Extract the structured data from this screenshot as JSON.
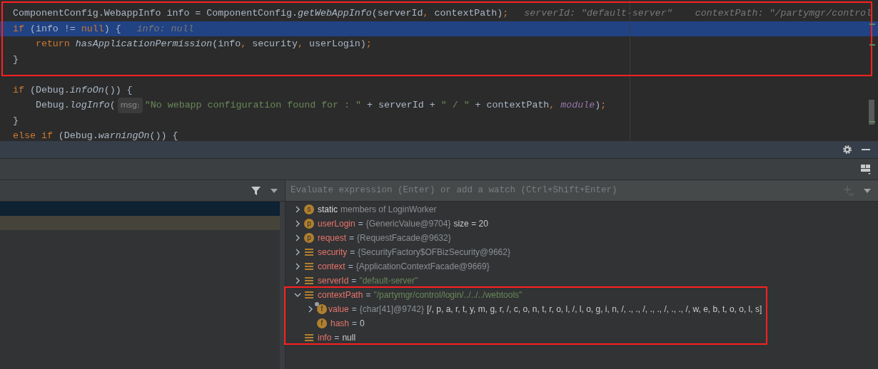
{
  "editor": {
    "lines": [
      {
        "highlighted": false,
        "segments": [
          {
            "kind": "code",
            "tokens": [
              {
                "kind": "plain",
                "text": "ComponentConfig.WebappInfo info = ComponentConfig."
              },
              {
                "kind": "method",
                "text": "getWebAppInfo"
              },
              {
                "kind": "plain",
                "text": "(serverId"
              },
              {
                "kind": "keyword",
                "text": ","
              },
              {
                "kind": "plain",
                "text": " contextPath)"
              },
              {
                "kind": "keyword",
                "text": ";"
              }
            ]
          },
          {
            "kind": "hint",
            "text": "serverId: \"default-server\""
          },
          {
            "kind": "hint",
            "text": "contextPath: \"/partymgr/control"
          }
        ]
      },
      {
        "highlighted": true,
        "segments": [
          {
            "kind": "code",
            "tokens": [
              {
                "kind": "keyword",
                "text": "if"
              },
              {
                "kind": "plain",
                "text": " (info != "
              },
              {
                "kind": "keyword",
                "text": "null"
              },
              {
                "kind": "plain",
                "text": ") {"
              }
            ]
          },
          {
            "kind": "hint",
            "text": "info: null"
          }
        ]
      },
      {
        "highlighted": false,
        "segments": [
          {
            "kind": "code",
            "tokens": [
              {
                "kind": "keyword",
                "text": "    return "
              },
              {
                "kind": "method",
                "text": "hasApplicationPermission"
              },
              {
                "kind": "plain",
                "text": "(info"
              },
              {
                "kind": "keyword",
                "text": ","
              },
              {
                "kind": "plain",
                "text": " security"
              },
              {
                "kind": "keyword",
                "text": ","
              },
              {
                "kind": "plain",
                "text": " userLogin)"
              },
              {
                "kind": "keyword",
                "text": ";"
              }
            ]
          }
        ]
      },
      {
        "highlighted": false,
        "segments": [
          {
            "kind": "code",
            "tokens": [
              {
                "kind": "plain",
                "text": "}"
              }
            ]
          }
        ]
      },
      {
        "highlighted": false
      },
      {
        "highlighted": false,
        "segments": [
          {
            "kind": "code",
            "tokens": [
              {
                "kind": "keyword",
                "text": "if"
              },
              {
                "kind": "plain",
                "text": " (Debug."
              },
              {
                "kind": "method",
                "text": "infoOn"
              },
              {
                "kind": "plain",
                "text": "()) {"
              }
            ]
          }
        ]
      },
      {
        "highlighted": false,
        "segments": [
          {
            "kind": "code",
            "tokens": [
              {
                "kind": "plain",
                "text": "    Debug."
              },
              {
                "kind": "method",
                "text": "logInfo"
              },
              {
                "kind": "plain",
                "text": "("
              }
            ]
          },
          {
            "kind": "param",
            "text": "msg:"
          },
          {
            "kind": "code",
            "tokens": [
              {
                "kind": "string",
                "text": "\"No webapp configuration found for : \""
              },
              {
                "kind": "plain",
                "text": " + serverId + "
              },
              {
                "kind": "string",
                "text": "\" / \""
              },
              {
                "kind": "plain",
                "text": " + contextPath"
              },
              {
                "kind": "keyword",
                "text": ","
              },
              {
                "kind": "field",
                "text": " module"
              },
              {
                "kind": "plain",
                "text": ")"
              },
              {
                "kind": "keyword",
                "text": ";"
              }
            ]
          }
        ]
      },
      {
        "highlighted": false,
        "segments": [
          {
            "kind": "code",
            "tokens": [
              {
                "kind": "plain",
                "text": "}"
              }
            ]
          }
        ]
      },
      {
        "highlighted": false,
        "segments": [
          {
            "kind": "code",
            "tokens": [
              {
                "kind": "keyword",
                "text": "else if"
              },
              {
                "kind": "plain",
                "text": " (Debug."
              },
              {
                "kind": "method",
                "text": "warningOn"
              },
              {
                "kind": "plain",
                "text": "()) {"
              }
            ]
          }
        ]
      }
    ]
  },
  "frames": {
    "rows": [
      {
        "selected": true
      },
      {
        "selected": false
      }
    ]
  },
  "evaluate": {
    "placeholder": "Evaluate expression (Enter) or add a watch (Ctrl+Shift+Enter)"
  },
  "variables": [
    {
      "kind": "static",
      "expandable": true,
      "expanded": false,
      "icon": {
        "kind": "letter",
        "letter": "s"
      },
      "name": "static",
      "value": [
        {
          "kind": "ref",
          "text": "members of LoginWorker"
        }
      ]
    },
    {
      "kind": "variable",
      "expandable": true,
      "expanded": false,
      "icon": {
        "kind": "letter",
        "letter": "p"
      },
      "name": "userLogin",
      "separator": "=",
      "value": [
        {
          "kind": "ref",
          "text": "{GenericValue@9704}"
        },
        {
          "kind": "plain",
          "text": "size = 20"
        }
      ]
    },
    {
      "kind": "variable",
      "expandable": true,
      "expanded": false,
      "icon": {
        "kind": "letter",
        "letter": "p"
      },
      "name": "request",
      "separator": "=",
      "value": [
        {
          "kind": "ref",
          "text": "{RequestFacade@9632}"
        }
      ]
    },
    {
      "kind": "variable",
      "expandable": true,
      "expanded": false,
      "icon": {
        "kind": "list"
      },
      "name": "security",
      "separator": "=",
      "value": [
        {
          "kind": "ref",
          "text": "{SecurityFactory$OFBizSecurity@9662}"
        }
      ]
    },
    {
      "kind": "variable",
      "expandable": true,
      "expanded": false,
      "icon": {
        "kind": "list"
      },
      "name": "context",
      "separator": "=",
      "value": [
        {
          "kind": "ref",
          "text": "{ApplicationContextFacade@9669}"
        }
      ]
    },
    {
      "kind": "variable",
      "expandable": true,
      "expanded": false,
      "icon": {
        "kind": "list"
      },
      "name": "serverId",
      "separator": "=",
      "value": [
        {
          "kind": "string",
          "text": "\"default-server\""
        }
      ]
    },
    {
      "kind": "variable",
      "expandable": true,
      "expanded": true,
      "icon": {
        "kind": "list"
      },
      "name": "contextPath",
      "separator": "=",
      "value": [
        {
          "kind": "string",
          "text": "\"/partymgr/control/login/../../../webtools\""
        }
      ],
      "children": [
        {
          "kind": "variable",
          "expandable": true,
          "expanded": false,
          "icon": {
            "kind": "letter_marked",
            "letter": "f"
          },
          "name": "value",
          "separator": "=",
          "value": [
            {
              "kind": "ref",
              "text": "{char[41]@9742}"
            },
            {
              "kind": "plain",
              "text": "[/, p, a, r, t, y, m, g, r, /, c, o, n, t, r, o, l, /, l, o, g, i, n, /, ., ., /, ., ., /, ., ., /, w, e, b, t, o, o, l, s]"
            }
          ]
        },
        {
          "kind": "variable",
          "expandable": false,
          "icon": {
            "kind": "letter",
            "letter": "f"
          },
          "name": "hash",
          "separator": "=",
          "value": [
            {
              "kind": "plain",
              "text": "0"
            }
          ]
        }
      ]
    },
    {
      "kind": "variable",
      "expandable": false,
      "icon": {
        "kind": "list"
      },
      "name": "info",
      "separator": "=",
      "value": [
        {
          "kind": "plain",
          "text": "null"
        }
      ]
    }
  ]
}
